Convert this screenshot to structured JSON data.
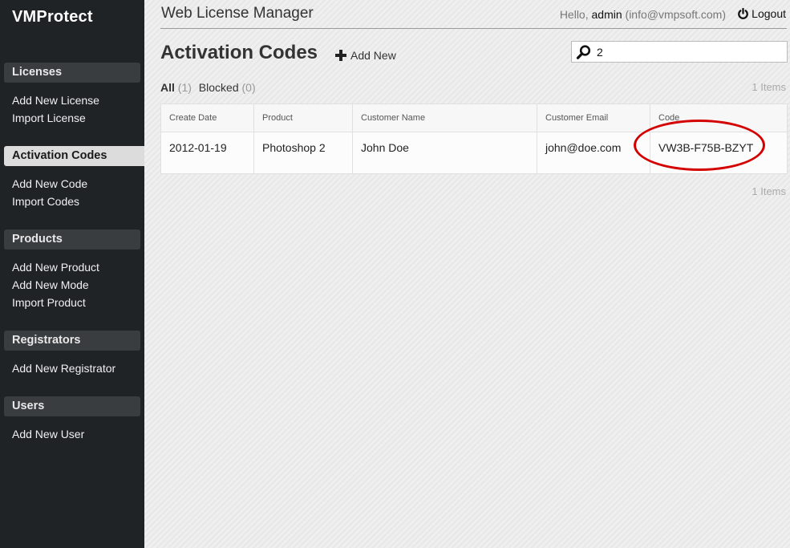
{
  "sidebar": {
    "brand": "VMProtect",
    "sections": [
      {
        "title": "Licenses",
        "items": [
          "Add New License",
          "Import License"
        ]
      },
      {
        "title": "Activation Codes",
        "items": [
          "Add New Code",
          "Import Codes"
        ]
      },
      {
        "title": "Products",
        "items": [
          "Add New Product",
          "Add New Mode",
          "Import Product"
        ]
      },
      {
        "title": "Registrators",
        "items": [
          "Add New Registrator"
        ]
      },
      {
        "title": "Users",
        "items": [
          "Add New User"
        ]
      }
    ]
  },
  "header": {
    "app_title": "Web License Manager",
    "hello": "Hello,",
    "username": "admin",
    "email": "(info@vmpsoft.com)",
    "logout": "Logout"
  },
  "page": {
    "title": "Activation Codes",
    "add_new": "Add New",
    "search_value": "2",
    "filters": {
      "all": "All",
      "all_count": "(1)",
      "blocked": "Blocked",
      "blocked_count": "(0)"
    },
    "items_count": "1 Items"
  },
  "table": {
    "columns": [
      "Create Date",
      "Product",
      "Customer Name",
      "Customer Email",
      "Code"
    ],
    "rows": [
      [
        "2012-01-19",
        "Photoshop 2",
        "John Doe",
        "john@doe.com",
        "VW3B-F75B-BZYT"
      ]
    ]
  },
  "colors": {
    "sidebar_bg": "#1f2326",
    "highlight": "#d40000"
  }
}
